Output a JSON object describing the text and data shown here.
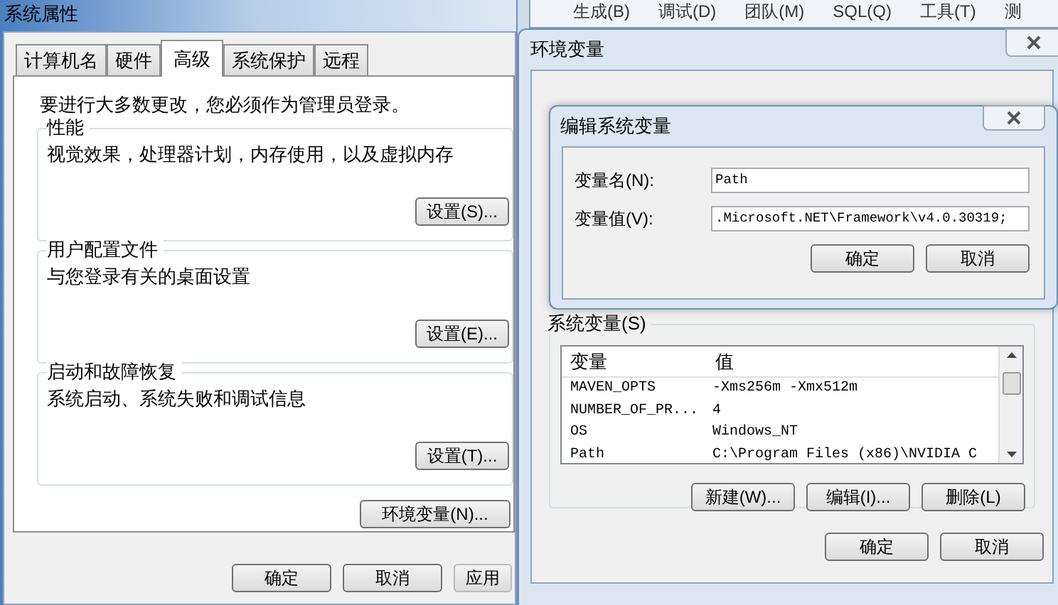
{
  "background_menu": [
    "生成(B)",
    "调试(D)",
    "团队(M)",
    "SQL(Q)",
    "工具(T)",
    "测"
  ],
  "system_properties": {
    "title": "系统属性",
    "tabs": [
      {
        "label": "计算机名",
        "selected": false
      },
      {
        "label": "硬件",
        "selected": false
      },
      {
        "label": "高级",
        "selected": true
      },
      {
        "label": "系统保护",
        "selected": false
      },
      {
        "label": "远程",
        "selected": false
      }
    ],
    "notice": "要进行大多数更改，您必须作为管理员登录。",
    "groups": [
      {
        "title": "性能",
        "description": "视觉效果，处理器计划，内存使用，以及虚拟内存",
        "button": "设置(S)..."
      },
      {
        "title": "用户配置文件",
        "description": "与您登录有关的桌面设置",
        "button": "设置(E)..."
      },
      {
        "title": "启动和故障恢复",
        "description": "系统启动、系统失败和调试信息",
        "button": "设置(T)..."
      }
    ],
    "env_button": "环境变量(N)...",
    "buttons": [
      {
        "label": "确定",
        "disabled": false
      },
      {
        "label": "取消",
        "disabled": false
      },
      {
        "label": "应用",
        "disabled": true
      }
    ]
  },
  "environment_variables": {
    "title": "环境变量",
    "system_group": "系统变量(S)",
    "columns": [
      "变量",
      "值"
    ],
    "rows": [
      {
        "name": "MAVEN_OPTS",
        "value": "-Xms256m -Xmx512m"
      },
      {
        "name": "NUMBER_OF_PR...",
        "value": "4"
      },
      {
        "name": "OS",
        "value": "Windows_NT"
      },
      {
        "name": "Path",
        "value": "C:\\Program Files (x86)\\NVIDIA C"
      }
    ],
    "list_buttons": [
      "新建(W)...",
      "编辑(I)...",
      "删除(L)"
    ],
    "buttons": [
      "确定",
      "取消"
    ]
  },
  "edit_dialog": {
    "title": "编辑系统变量",
    "fields": [
      {
        "label": "变量名(N):",
        "value": "Path"
      },
      {
        "label": "变量值(V):",
        "value": ".Microsoft.NET\\Framework\\v4.0.30319;"
      }
    ],
    "buttons": [
      "确定",
      "取消"
    ]
  }
}
